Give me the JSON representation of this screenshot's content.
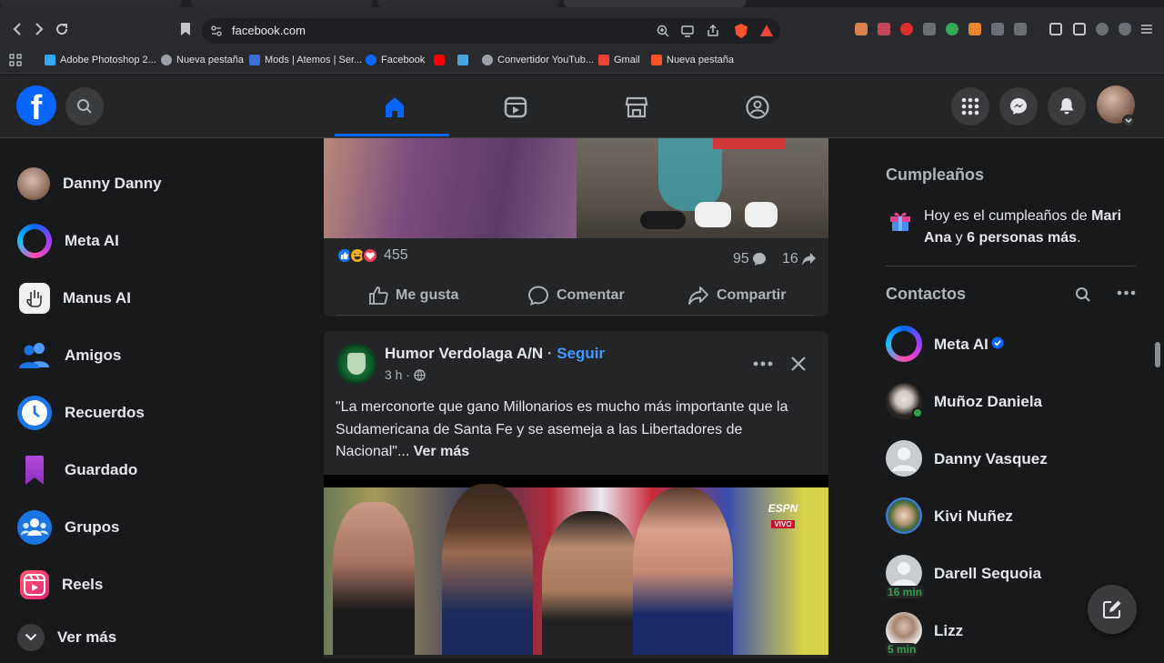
{
  "browser": {
    "url": "facebook.com",
    "bookmarks": [
      {
        "label": "Adobe Photoshop 2...",
        "icon": "photoshop-icon"
      },
      {
        "label": "Nueva pestaña",
        "icon": "globe-icon"
      },
      {
        "label": "Mods | Atemos | Ser...",
        "icon": "mods-icon"
      },
      {
        "label": "Facebook",
        "icon": "facebook-icon"
      },
      {
        "label": "",
        "icon": "youtube-icon"
      },
      {
        "label": "",
        "icon": "l-icon"
      },
      {
        "label": "Convertidor YouTub...",
        "icon": "globe-icon"
      },
      {
        "label": "Gmail",
        "icon": "gmail-icon"
      },
      {
        "label": "Nueva pestaña",
        "icon": "brave-icon"
      }
    ]
  },
  "sidebar": {
    "items": [
      {
        "label": "Danny Danny",
        "icon": "profile-avatar"
      },
      {
        "label": "Meta AI",
        "icon": "meta-ai-icon"
      },
      {
        "label": "Manus AI",
        "icon": "manus-ai-icon"
      },
      {
        "label": "Amigos",
        "icon": "friends-icon"
      },
      {
        "label": "Recuerdos",
        "icon": "memories-icon"
      },
      {
        "label": "Guardado",
        "icon": "saved-icon"
      },
      {
        "label": "Grupos",
        "icon": "groups-icon"
      },
      {
        "label": "Reels",
        "icon": "reels-icon"
      }
    ],
    "see_more": "Ver más"
  },
  "post1": {
    "reaction_count": "455",
    "comment_count": "95",
    "share_count": "16",
    "like_label": "Me gusta",
    "comment_label": "Comentar",
    "share_label": "Compartir"
  },
  "post2": {
    "author": "Humor Verdolaga A/N",
    "separator": " · ",
    "follow": "Seguir",
    "time": "3 h ·",
    "text": "\"La merconorte que gano Millonarios es mucho más importante que la Sudamericana de Santa Fe y se asemeja a las Libertadores de Nacional\"...",
    "see_more": "Ver más",
    "badge_line1": "ESPN",
    "badge_line2": "VIVO"
  },
  "right": {
    "birthdays_title": "Cumpleaños",
    "birthday_text_a": "Hoy es el cumpleaños de ",
    "birthday_name": "Mari Ana",
    "birthday_text_b": " y ",
    "birthday_others": "6 personas más",
    "birthday_end": ".",
    "contacts_title": "Contactos",
    "contacts": [
      {
        "name": "Meta AI",
        "verified": true
      },
      {
        "name": "Muñoz Daniela",
        "online": true
      },
      {
        "name": "Danny Vasquez"
      },
      {
        "name": "Kivi Nuñez"
      },
      {
        "name": "Darell Sequoia",
        "minutes": "16 min"
      },
      {
        "name": "Lizz",
        "minutes": "5 min"
      }
    ]
  },
  "colors": {
    "brand": "#0866ff",
    "online": "#31a24c",
    "link": "#4599ff"
  }
}
